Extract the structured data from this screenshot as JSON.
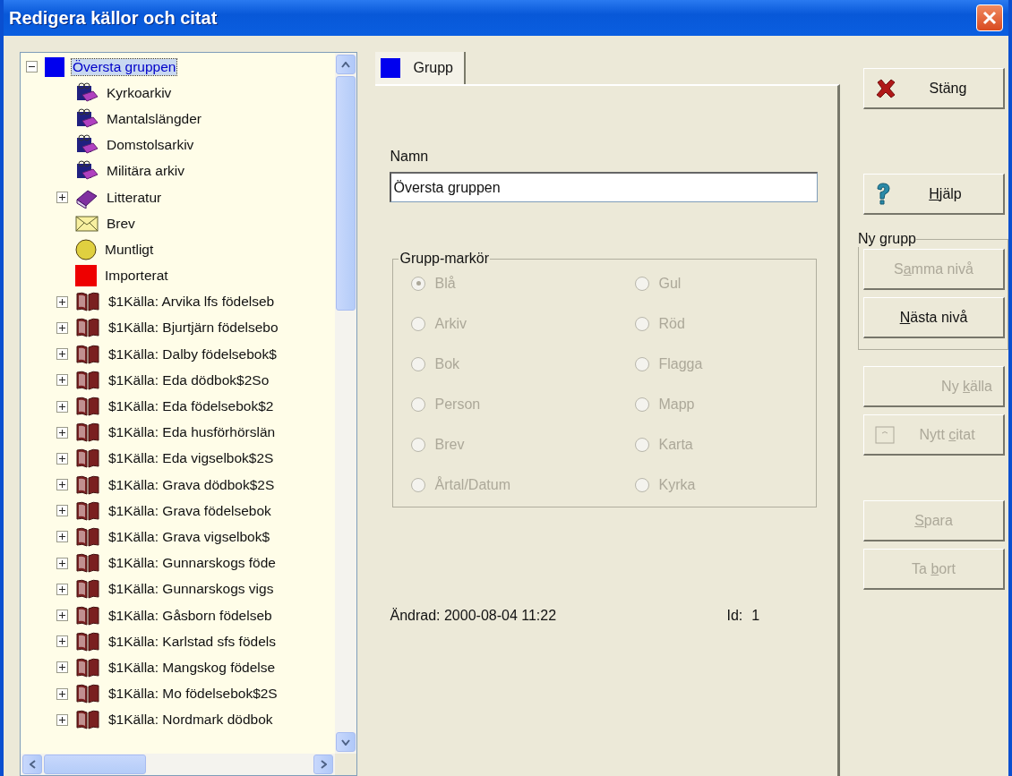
{
  "window": {
    "title": "Redigera källor och citat"
  },
  "tree": {
    "items": [
      {
        "label": "Översta gruppen",
        "kind": "group",
        "selected": true,
        "expanded": true,
        "children": [
          {
            "label": "Kyrkoarkiv",
            "kind": "archive",
            "selected": false
          },
          {
            "label": "Mantalslängder",
            "kind": "archive",
            "selected": false
          },
          {
            "label": "Domstolsarkiv",
            "kind": "archive",
            "selected": false
          },
          {
            "label": "Militära arkiv",
            "kind": "archive",
            "selected": false
          },
          {
            "label": "Litteratur",
            "kind": "books",
            "selected": false,
            "expanded": false
          },
          {
            "label": "Brev",
            "kind": "letter",
            "selected": false
          },
          {
            "label": "Muntligt",
            "kind": "person",
            "selected": false
          },
          {
            "label": "Importerat",
            "kind": "imported",
            "selected": false
          },
          {
            "label": "$1Källa: Arvika lfs födelseb",
            "kind": "source",
            "selected": false,
            "expanded": false
          },
          {
            "label": "$1Källa: Bjurtjärn födelsebo",
            "kind": "source",
            "selected": false,
            "expanded": false
          },
          {
            "label": "$1Källa: Dalby födelsebok$",
            "kind": "source",
            "selected": false,
            "expanded": false
          },
          {
            "label": "$1Källa: Eda dödbok$2So",
            "kind": "source",
            "selected": false,
            "expanded": false
          },
          {
            "label": "$1Källa: Eda födelsebok$2",
            "kind": "source",
            "selected": false,
            "expanded": false
          },
          {
            "label": "$1Källa: Eda husförhörslän",
            "kind": "source",
            "selected": false,
            "expanded": false
          },
          {
            "label": "$1Källa: Eda vigselbok$2S",
            "kind": "source",
            "selected": false,
            "expanded": false
          },
          {
            "label": "$1Källa: Grava dödbok$2S",
            "kind": "source",
            "selected": false,
            "expanded": false
          },
          {
            "label": "$1Källa: Grava födelsebok",
            "kind": "source",
            "selected": false,
            "expanded": false
          },
          {
            "label": "$1Källa: Grava vigselbok$",
            "kind": "source",
            "selected": false,
            "expanded": false
          },
          {
            "label": "$1Källa: Gunnarskogs föde",
            "kind": "source",
            "selected": false,
            "expanded": false
          },
          {
            "label": "$1Källa: Gunnarskogs vigs",
            "kind": "source",
            "selected": false,
            "expanded": false
          },
          {
            "label": "$1Källa: Gåsborn födelseb",
            "kind": "source",
            "selected": false,
            "expanded": false
          },
          {
            "label": "$1Källa: Karlstad sfs födels",
            "kind": "source",
            "selected": false,
            "expanded": false
          },
          {
            "label": "$1Källa: Mangskog födelse",
            "kind": "source",
            "selected": false,
            "expanded": false
          },
          {
            "label": "$1Källa: Mo födelsebok$2S",
            "kind": "source",
            "selected": false,
            "expanded": false
          },
          {
            "label": "$1Källa: Nordmark dödbok",
            "kind": "source",
            "selected": false,
            "expanded": false
          }
        ]
      }
    ]
  },
  "tabs": [
    {
      "label": "Grupp",
      "selected": true
    }
  ],
  "name_field": {
    "label": "Namn",
    "value": "Översta gruppen"
  },
  "marker_group": {
    "title": "Grupp-markör",
    "disabled": true,
    "options": [
      {
        "label": "Blå",
        "selected": true
      },
      {
        "label": "Gul",
        "selected": false
      },
      {
        "label": "Arkiv",
        "selected": false
      },
      {
        "label": "Röd",
        "selected": false
      },
      {
        "label": "Bok",
        "selected": false
      },
      {
        "label": "Flagga",
        "selected": false
      },
      {
        "label": "Person",
        "selected": false
      },
      {
        "label": "Mapp",
        "selected": false
      },
      {
        "label": "Brev",
        "selected": false
      },
      {
        "label": "Karta",
        "selected": false
      },
      {
        "label": "Årtal/Datum",
        "selected": false
      },
      {
        "label": "Kyrka",
        "selected": false
      }
    ]
  },
  "changed": "Ändrad: 2000-08-04 11:22",
  "id_label": "Id:",
  "id_value": "1",
  "buttons_top": [
    {
      "kind": "close",
      "post": "Stäng",
      "disabled": false
    },
    {
      "kind": "help",
      "key": "H",
      "post": "jälp",
      "disabled": false
    }
  ],
  "new_group": {
    "title": "Ny grupp",
    "buttons": [
      {
        "kind": "plain",
        "pre": "S",
        "key": "a",
        "post": "mma nivå",
        "disabled": true
      },
      {
        "kind": "plain",
        "key": "N",
        "post": "ästa nivå",
        "disabled": false
      }
    ]
  },
  "buttons_bottom": [
    {
      "kind": "right",
      "pre": "Ny ",
      "key": "k",
      "post": "älla",
      "disabled": true
    },
    {
      "kind": "quote",
      "pre": "Nytt ",
      "key": "c",
      "post": "itat",
      "disabled": true
    },
    {
      "kind": "gap"
    },
    {
      "kind": "plain",
      "key": "S",
      "post": "para",
      "disabled": true
    },
    {
      "kind": "plain",
      "pre": "Ta ",
      "key": "b",
      "post": "ort",
      "disabled": true
    }
  ]
}
